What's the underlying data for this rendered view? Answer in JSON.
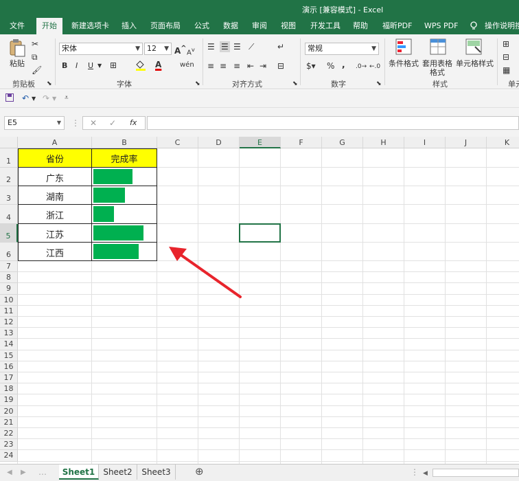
{
  "window": {
    "title": "演示 [兼容模式] - Excel"
  },
  "ribbon_tabs": [
    {
      "label": "文件",
      "active": false
    },
    {
      "label": "开始",
      "active": true
    },
    {
      "label": "新建选项卡",
      "active": false
    },
    {
      "label": "插入",
      "active": false
    },
    {
      "label": "页面布局",
      "active": false
    },
    {
      "label": "公式",
      "active": false
    },
    {
      "label": "数据",
      "active": false
    },
    {
      "label": "审阅",
      "active": false
    },
    {
      "label": "视图",
      "active": false
    },
    {
      "label": "开发工具",
      "active": false
    },
    {
      "label": "帮助",
      "active": false
    },
    {
      "label": "福昕PDF",
      "active": false
    },
    {
      "label": "WPS PDF",
      "active": false
    },
    {
      "label": "操作说明搜",
      "active": false
    }
  ],
  "ribbon": {
    "paste_label": "粘贴",
    "clipboard_label": "剪贴板",
    "font_name": "宋体",
    "font_size": "12",
    "font_label": "字体",
    "align_label": "对齐方式",
    "number_format": "常规",
    "number_label": "数字",
    "cond_format_label": "条件格式",
    "table_format_label": "套用表格格式",
    "cell_style_label": "单元格样式",
    "styles_label": "样式",
    "cells_label": "单元",
    "bold": "B",
    "italic": "I",
    "underline": "U",
    "grow_font": "A",
    "shrink_font": "A",
    "font_color_glyph": "A",
    "percent": "%",
    "comma": ","
  },
  "formula_bar": {
    "name_box": "E5",
    "fx": "fx",
    "formula": ""
  },
  "columns": [
    "A",
    "B",
    "C",
    "D",
    "E",
    "F",
    "G",
    "H",
    "I",
    "J",
    "K"
  ],
  "rows": [
    "1",
    "2",
    "3",
    "4",
    "5",
    "6",
    "7",
    "8",
    "9",
    "10",
    "11",
    "12",
    "13",
    "14",
    "15",
    "16",
    "17",
    "18",
    "19",
    "20",
    "21",
    "22",
    "23",
    "24"
  ],
  "selected_cell": {
    "col": "E",
    "row": "5"
  },
  "table": {
    "headers": [
      "省份",
      "完成率"
    ],
    "rows": [
      {
        "province": "广东",
        "rate": 0.63
      },
      {
        "province": "湖南",
        "rate": 0.5
      },
      {
        "province": "浙江",
        "rate": 0.33
      },
      {
        "province": "江苏",
        "rate": 0.8
      },
      {
        "province": "江西",
        "rate": 0.73
      }
    ]
  },
  "sheets": [
    {
      "label": "Sheet1",
      "active": true
    },
    {
      "label": "Sheet2",
      "active": false
    },
    {
      "label": "Sheet3",
      "active": false
    }
  ],
  "colors": {
    "accent": "#217346",
    "header_fill": "#ffff00",
    "bar": "#00b050",
    "arrow": "#e8242c"
  }
}
